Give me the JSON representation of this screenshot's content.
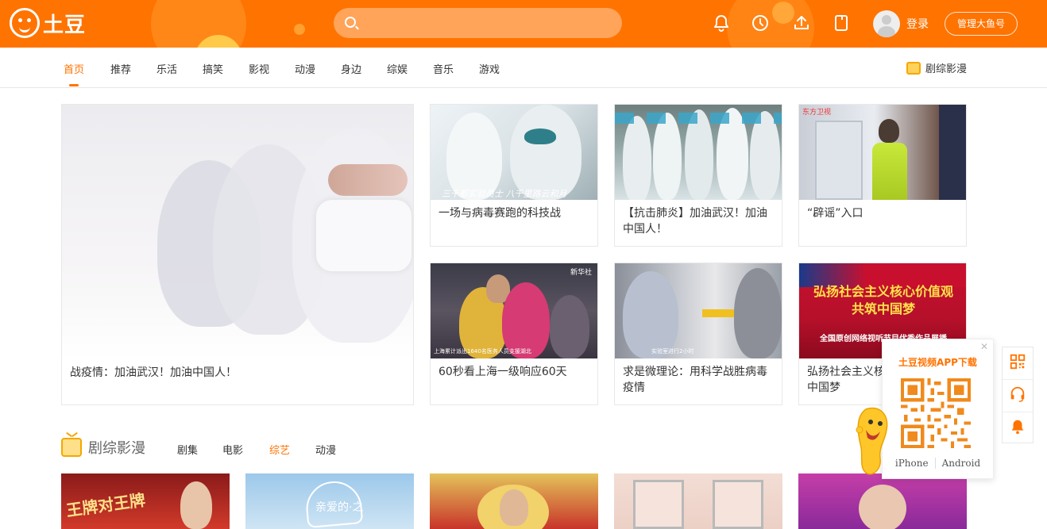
{
  "header": {
    "logo_text": "土豆",
    "search_placeholder": "",
    "icons": [
      "bell-icon",
      "history-clock-icon",
      "upload-icon",
      "bookmark-icon"
    ],
    "login_label": "登录",
    "manage_label": "管理大鱼号",
    "brand_color": "#ff7300"
  },
  "nav": {
    "items": [
      "首页",
      "推荐",
      "乐活",
      "搞笑",
      "影视",
      "动漫",
      "身边",
      "综娱",
      "音乐",
      "游戏"
    ],
    "active_index": 0,
    "right_label": "剧综影漫"
  },
  "feature": {
    "big": {
      "title": "战疫情：加油武汉！加油中国人！"
    },
    "cards": [
      {
        "title": "一场与病毒赛跑的科技战",
        "overlay": "三千都实验员士 八千里路云和月"
      },
      {
        "title": "【抗击肺炎】加油武汉！加油中国人！"
      },
      {
        "title": "“辟谣”入口",
        "overlay": "东方卫视"
      },
      {
        "title": "60秒看上海一级响应60天",
        "overlay": "上海累计派出1640名医务人员支援湖北",
        "overlay_top": "新华社"
      },
      {
        "title": "求是微理论：用科学战胜病毒疫情",
        "overlay": "实验室进行2小时"
      },
      {
        "title": "弘扬社会主义核心价值观 共筑中国梦",
        "overlay_line1": "弘扬社会主义核心价值观",
        "overlay_line2": "共筑中国梦",
        "overlay_line3": "全国原创网络视听节目优秀作品展播"
      }
    ]
  },
  "section2": {
    "title": "剧综影漫",
    "tabs": [
      "剧集",
      "电影",
      "综艺",
      "动漫"
    ],
    "active_tab_index": 2,
    "poster_overlays": [
      "王牌对王牌",
      "亲爱的·之"
    ]
  },
  "app_popup": {
    "title": "土豆视频APP下载",
    "close_label": "✕",
    "links": [
      "iPhone",
      "Android"
    ]
  },
  "sidebar": {
    "icons": [
      "qr-code-icon",
      "customer-service-icon",
      "notification-bell-icon"
    ]
  }
}
